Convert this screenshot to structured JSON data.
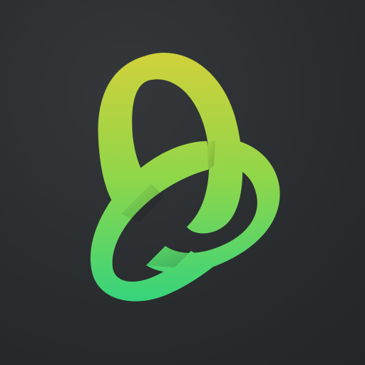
{
  "app_icon": {
    "icon_name": "knot-logo-icon",
    "colors": {
      "background": "#2b2d2f",
      "gradient_top": "#d2d13a",
      "gradient_mid": "#8fd64a",
      "gradient_bottom": "#32d47e"
    }
  }
}
